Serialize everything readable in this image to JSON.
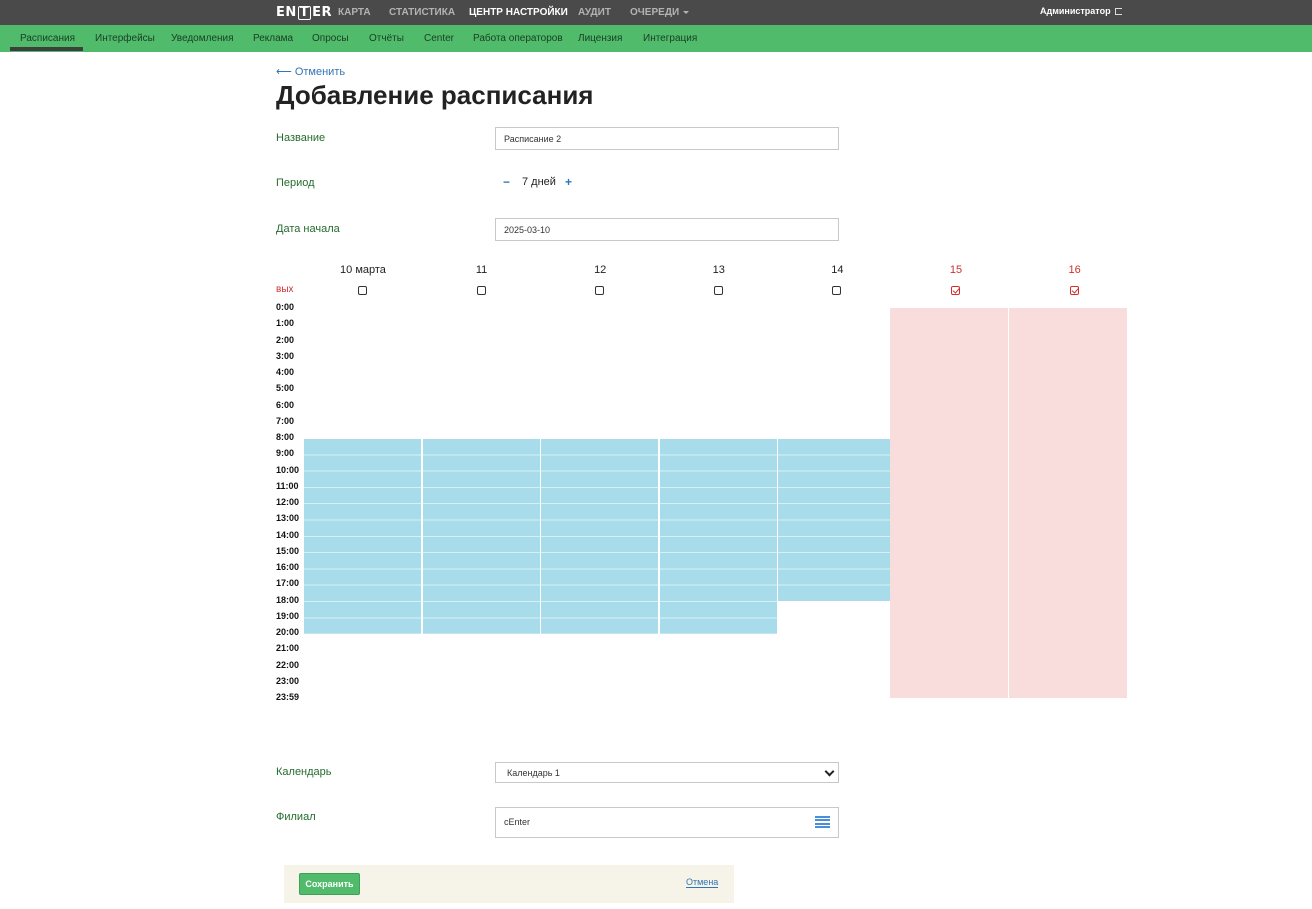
{
  "app": {
    "logo": {
      "left": "EN",
      "box": "T",
      "right": "ER"
    },
    "top_nav": [
      {
        "label": "КАРТА",
        "active": false
      },
      {
        "label": "СТАТИСТИКА",
        "active": false
      },
      {
        "label": "ЦЕНТР НАСТРОЙКИ",
        "active": true
      },
      {
        "label": "АУДИТ",
        "active": false
      },
      {
        "label": "ОЧЕРЕДИ",
        "active": false,
        "dropdown": true
      }
    ],
    "user": "Администратор",
    "sub_nav": [
      {
        "label": "Расписания",
        "active": true
      },
      {
        "label": "Интерфейсы"
      },
      {
        "label": "Уведомления"
      },
      {
        "label": "Реклама"
      },
      {
        "label": "Опросы"
      },
      {
        "label": "Отчёты"
      },
      {
        "label": "Center"
      },
      {
        "label": "Работа операторов"
      },
      {
        "label": "Лицензия"
      },
      {
        "label": "Интеграция"
      }
    ]
  },
  "page": {
    "back_link": "⟵ Отменить",
    "title": "Добавление расписания"
  },
  "form": {
    "name_label": "Название",
    "name_value": "Расписание 2",
    "period_label": "Период",
    "period_minus": "−",
    "period_value": "7 дней",
    "period_plus": "+",
    "start_label": "Дата начала",
    "start_value": "2025-03-10",
    "calendar_label": "Календарь",
    "calendar_value": "Календарь 1",
    "branch_label": "Филиал",
    "branch_value": "cEnter"
  },
  "schedule": {
    "weekend_label": "вых",
    "days": [
      {
        "label": "10 марта",
        "weekend": false,
        "start": 8,
        "end": 20
      },
      {
        "label": "11",
        "weekend": false,
        "start": 8,
        "end": 20
      },
      {
        "label": "12",
        "weekend": false,
        "start": 8,
        "end": 20
      },
      {
        "label": "13",
        "weekend": false,
        "start": 8,
        "end": 20
      },
      {
        "label": "14",
        "weekend": false,
        "start": 8,
        "end": 18
      },
      {
        "label": "15",
        "weekend": true
      },
      {
        "label": "16",
        "weekend": true
      }
    ],
    "hours": [
      "0:00",
      "1:00",
      "2:00",
      "3:00",
      "4:00",
      "5:00",
      "6:00",
      "7:00",
      "8:00",
      "9:00",
      "10:00",
      "11:00",
      "12:00",
      "13:00",
      "14:00",
      "15:00",
      "16:00",
      "17:00",
      "18:00",
      "19:00",
      "20:00",
      "21:00",
      "22:00",
      "23:00",
      "23:59"
    ]
  },
  "actions": {
    "save": "Сохранить",
    "cancel": "Отмена"
  },
  "colors": {
    "topbar": "#4a4a4a",
    "subnav": "#4fbb6b",
    "busy": "#a9dceb",
    "weekend": "#f9dcdc",
    "label_green": "#246b2d",
    "link_blue": "#3275b5",
    "weekend_red": "#d0302f"
  }
}
